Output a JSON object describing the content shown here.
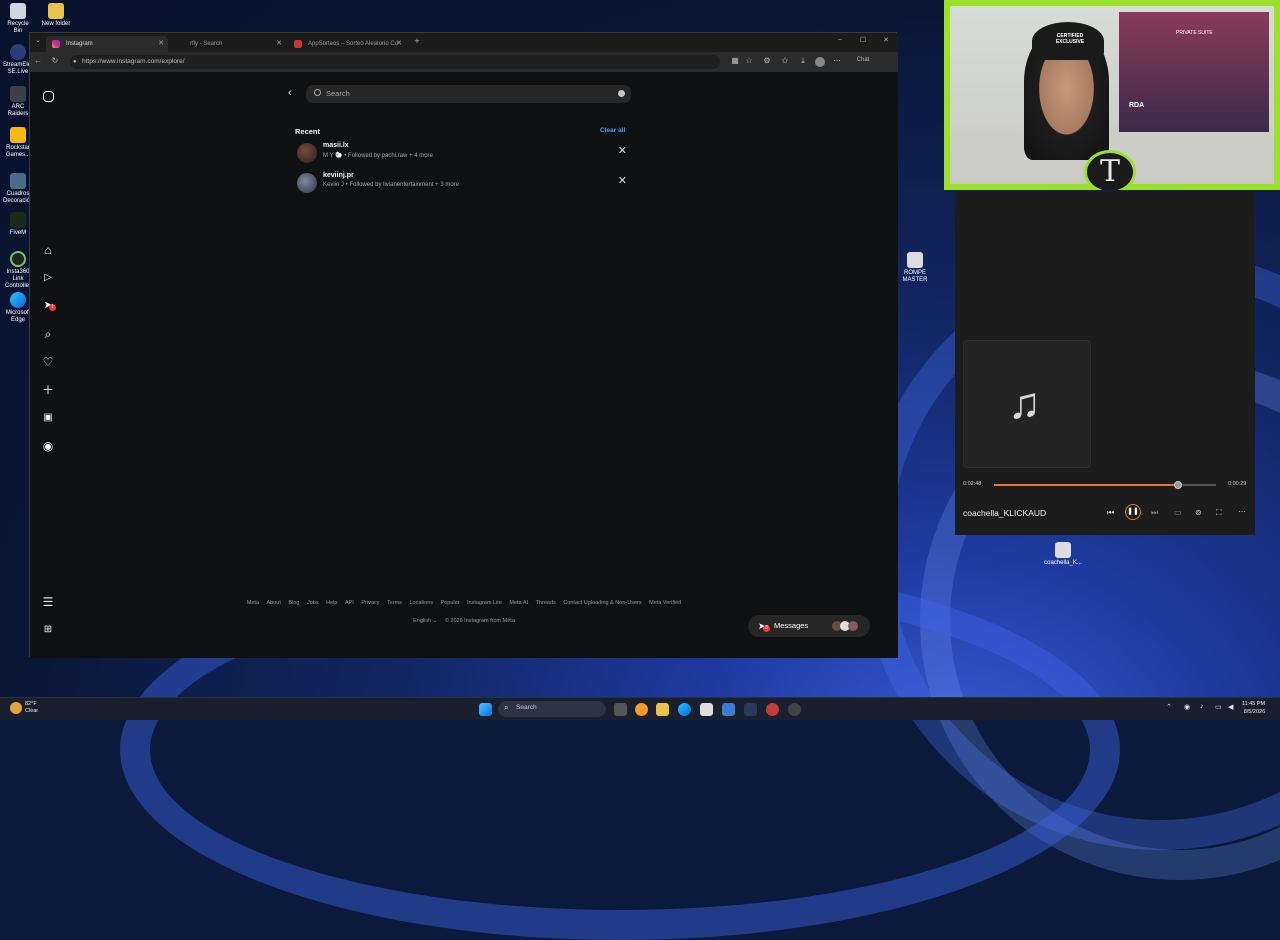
{
  "desktop": {
    "icons": [
      {
        "label": "Recycle Bin"
      },
      {
        "label": "New folder"
      },
      {
        "label": "StreamElements SE.Live"
      },
      {
        "label": "ARC Raiders"
      },
      {
        "label": "Rockstar Games..."
      },
      {
        "label": "Cuadros Decoración"
      },
      {
        "label": "FiveM"
      },
      {
        "label": "Insta360 Link Controller"
      },
      {
        "label": "Microsoft Edge"
      }
    ],
    "right_icons": [
      {
        "label": "ROMPE MASTER"
      },
      {
        "label": "coachella_K..."
      }
    ]
  },
  "browser": {
    "tabs": [
      {
        "label": "Instagram",
        "active": true
      },
      {
        "label": "rfly - Search",
        "active": false
      },
      {
        "label": "AppSorteos – Sorteo Aleatorio Co",
        "active": false
      }
    ],
    "url": "https://www.instagram.com/explore/",
    "copilot_label": "Chat"
  },
  "instagram": {
    "search_placeholder": "Search",
    "recent_heading": "Recent",
    "clear_all": "Clear all",
    "recent": [
      {
        "username": "masii.lx",
        "subtitle": "M Y 🐑 • Followed by pachi.raw + 4 more"
      },
      {
        "username": "keviinj.pr",
        "subtitle": "Keviin J • Followed by livianentertainment + 3 more"
      }
    ],
    "footer_links": [
      "Meta",
      "About",
      "Blog",
      "Jobs",
      "Help",
      "API",
      "Privacy",
      "Terms",
      "Locations",
      "Popular",
      "Instagram Lite",
      "Meta AI",
      "Threads",
      "Contact Uploading & Non-Users",
      "Meta Verified"
    ],
    "language": "English",
    "copyright": "© 2026 Instagram from Meta",
    "messages_label": "Messages",
    "notification_badge": "1",
    "messages_badge": "3"
  },
  "media_player": {
    "elapsed": "0:02:48",
    "total": "0:00:29",
    "progress": 0.83,
    "track_title": "coachella_KLICKAUD"
  },
  "taskbar": {
    "weather_temp": "82°F",
    "weather_cond": "Clear",
    "search_placeholder": "Search",
    "time": "11:45 PM",
    "date": "8/5/2026"
  },
  "webcam_overlay": {
    "hat_text": "CERTIFIED EXCLUSIVE",
    "sign_text": "PRIVATE SUITE"
  },
  "colors": {
    "accent_link": "#4aa3ff",
    "progress": "#e8743b",
    "cam_frame": "#9be12a"
  }
}
